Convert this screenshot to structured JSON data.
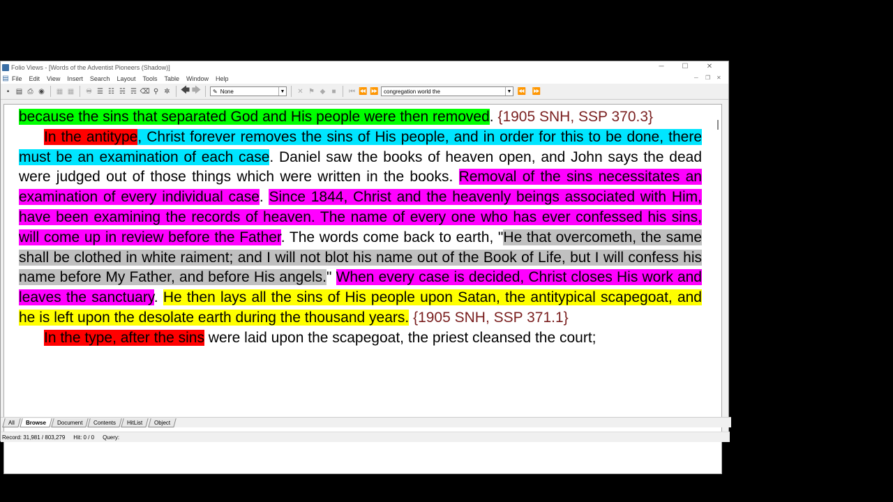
{
  "window": {
    "title": "Folio Views - [Words of the Adventist Pioneers (Shadow)]"
  },
  "menu": [
    "File",
    "Edit",
    "View",
    "Insert",
    "Search",
    "Layout",
    "Tools",
    "Table",
    "Window",
    "Help"
  ],
  "toolbar": {
    "style_combo": "None",
    "query_combo": "congregation world the"
  },
  "content": {
    "p1": {
      "s1": "because the sins that separated God and His people were then removed",
      "s2": ". ",
      "ref": "{1905 SNH, SSP 370.3}"
    },
    "p2": {
      "s1": "In the antitype",
      "s2": ", Christ forever removes the sins of His people, and in order for this to be done, there must be an examination of each case",
      "s3": ". Daniel saw the books of heaven open, and John says the dead were judged out of those things which were written in the books. ",
      "s4": "Removal of the sins necessitates an examination of every individual case",
      "s5": ". ",
      "s6": "Since 1844, Christ and the heavenly beings associated with Him, have been examining the records of heaven. The name of every one who has ever confessed his sins, will come up in review before the Father",
      "s7": ". The words come back to earth, \"",
      "s8": "He that overcometh, the same shall be clothed in white raiment; and I will not blot his name out of the Book of Life, but I will confess his name before My Father, and before His angels.",
      "s9": "\" ",
      "s10": "When every case is decided, Christ closes His work and leaves the sanctuary",
      "s11": ". ",
      "s12": "He then lays all the sins of His people upon Satan, the antitypical scapegoat, and he is left upon the desolate earth during the thousand years.",
      "s13": " ",
      "ref": "{1905 SNH, SSP 371.1}"
    },
    "p3": {
      "s1": "In the type, after the sins",
      "s2": " were laid upon the scapegoat, the priest cleansed the court;"
    }
  },
  "tabs": [
    "All",
    "Browse",
    "Document",
    "Contents",
    "HitList",
    "Object"
  ],
  "active_tab": "Browse",
  "status": {
    "record": "Record: 31,981 / 803,279",
    "hit": "Hit: 0 / 0",
    "query": "Query:"
  },
  "colors": {
    "green": "#00ff00",
    "red": "#ff0000",
    "cyan": "#00e5ff",
    "magenta": "#ff00ff",
    "gray": "#c0c0c0",
    "yellow": "#ffff00",
    "reference": "#7a1f1f"
  }
}
